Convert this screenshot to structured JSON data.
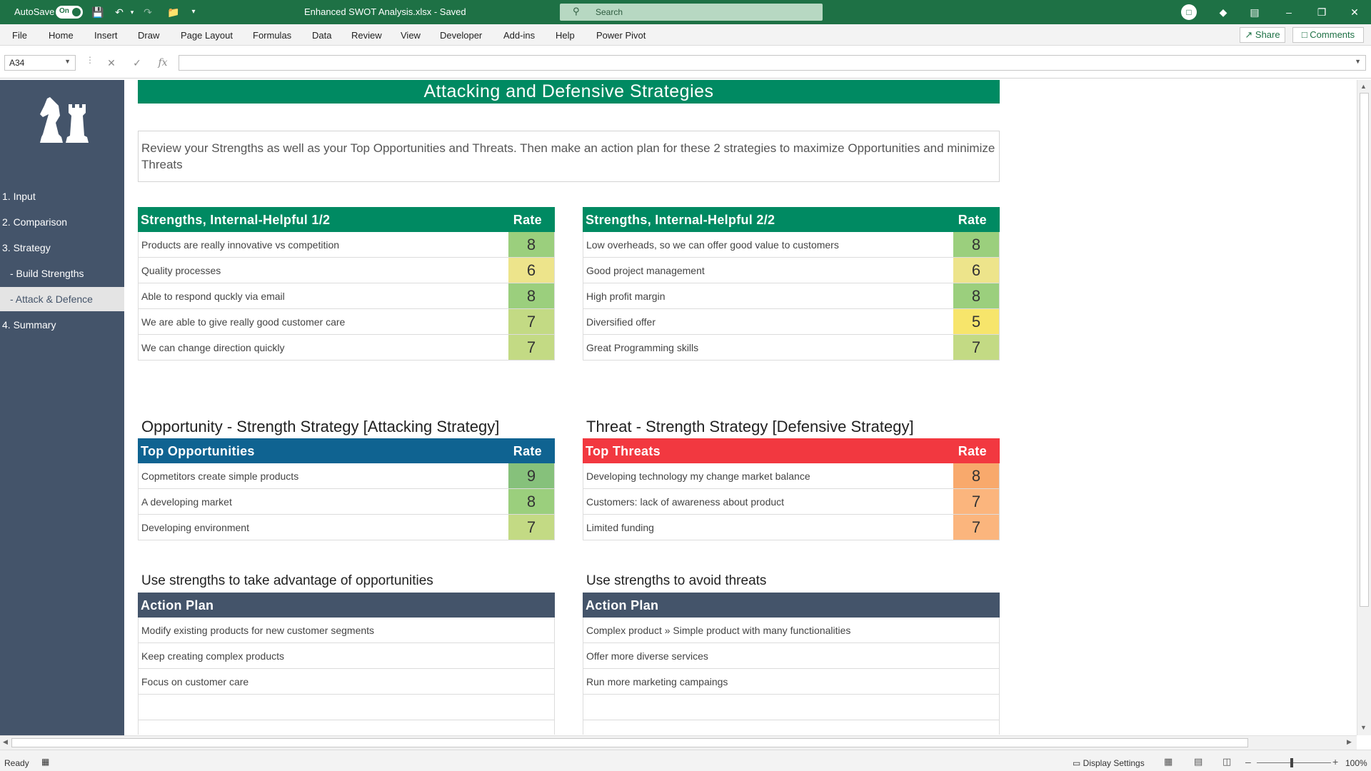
{
  "titlebar": {
    "autosave_label": "AutoSave",
    "autosave_state": "On",
    "doc_title": "Enhanced SWOT Analysis.xlsx  -  Saved",
    "search_placeholder": "Search"
  },
  "ribbon": {
    "tabs": [
      "File",
      "Home",
      "Insert",
      "Draw",
      "Page Layout",
      "Formulas",
      "Data",
      "Review",
      "View",
      "Developer",
      "Add-ins",
      "Help",
      "Power Pivot"
    ],
    "share": "Share",
    "comments": "Comments"
  },
  "formula_bar": {
    "name_box": "A34",
    "formula": ""
  },
  "sidebar": {
    "items": [
      {
        "label": "1. Input"
      },
      {
        "label": "2. Comparison"
      },
      {
        "label": "3. Strategy"
      },
      {
        "label": "  - Build Strengths"
      },
      {
        "label": "  - Attack & Defence"
      },
      {
        "label": "4. Summary"
      }
    ]
  },
  "sheet": {
    "banner": "Attacking and Defensive Strategies",
    "intro": "Review your Strengths as well as your Top Opportunities and Threats. Then make an action plan for these 2 strategies to maximize Opportunities and minimize Threats",
    "rate_label": "Rate",
    "strengths1": {
      "title": "Strengths, Internal-Helpful 1/2",
      "rows": [
        {
          "text": "Products are really innovative vs competition",
          "rate": "8"
        },
        {
          "text": "Quality processes",
          "rate": "6"
        },
        {
          "text": "Able to respond quckly via email",
          "rate": "8"
        },
        {
          "text": "We are able to give really good customer care",
          "rate": "7"
        },
        {
          "text": "We can change direction quickly",
          "rate": "7"
        }
      ]
    },
    "strengths2": {
      "title": "Strengths, Internal-Helpful 2/2",
      "rows": [
        {
          "text": "Low overheads, so we can offer good value to customers",
          "rate": "8"
        },
        {
          "text": "Good project management",
          "rate": "6"
        },
        {
          "text": "High profit margin",
          "rate": "8"
        },
        {
          "text": "Diversified offer",
          "rate": "5"
        },
        {
          "text": "Great Programming skills",
          "rate": "7"
        }
      ]
    },
    "attack_title": "Opportunity - Strength Strategy [Attacking Strategy]",
    "defend_title": "Threat - Strength Strategy [Defensive Strategy]",
    "opportunities": {
      "title": "Top Opportunities",
      "rows": [
        {
          "text": "Copmetitors create simple products",
          "rate": "9"
        },
        {
          "text": "A developing market",
          "rate": "8"
        },
        {
          "text": "Developing environment",
          "rate": "7"
        }
      ]
    },
    "threats": {
      "title": "Top Threats",
      "rows": [
        {
          "text": "Developing technology my change market balance",
          "rate": "8"
        },
        {
          "text": "Customers: lack of awareness about product",
          "rate": "7"
        },
        {
          "text": "Limited funding",
          "rate": "7"
        }
      ]
    },
    "attack_sub": "Use strengths to take advantage of opportunities",
    "defend_sub": "Use strengths to avoid threats",
    "action_plan_label": "Action Plan",
    "attack_plan": [
      "Modify existing products for new customer segments",
      "Keep creating complex products",
      "Focus on customer care",
      "",
      ""
    ],
    "defend_plan": [
      "Complex product » Simple product with many functionalities",
      "Offer more diverse services",
      "Run more marketing campaings",
      "",
      ""
    ]
  },
  "statusbar": {
    "ready": "Ready",
    "display_settings": "Display Settings",
    "zoom": "100%"
  },
  "colors": {
    "excel_green": "#1e7145",
    "banner_green": "#008a62",
    "opportunity_blue": "#0f6391",
    "threat_red": "#f23840",
    "action_navy": "#44546a"
  }
}
